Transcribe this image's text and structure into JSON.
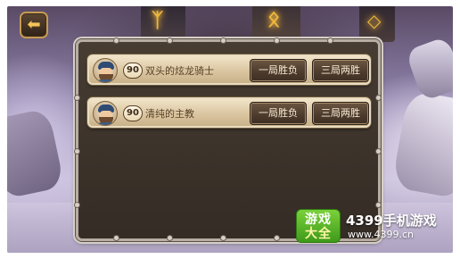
{
  "header": {
    "back_icon": "back-arrow-icon",
    "back_symbol": "⬅"
  },
  "players": [
    {
      "level": "90",
      "name": "双头的炫龙骑士",
      "avatar_icon": "bearded-warrior-avatar",
      "actions": {
        "one_round": "一局胜负",
        "best_of_three": "三局两胜"
      }
    },
    {
      "level": "90",
      "name": "清纯的主教",
      "avatar_icon": "bearded-warrior-avatar",
      "actions": {
        "one_round": "一局胜负",
        "best_of_three": "三局两胜"
      }
    }
  ],
  "watermark": {
    "logo_line1": "游戏",
    "logo_line2": "大全",
    "brand": "4399手机游戏",
    "url": "www.4399.cn"
  },
  "colors": {
    "panel_bg": "#3b322a",
    "row_bg": "#dcc8a4",
    "button_bg": "#4e3c2d",
    "button_text": "#f6ead2",
    "accent_gold": "#f0b83a",
    "watermark_green": "#4ca722"
  }
}
